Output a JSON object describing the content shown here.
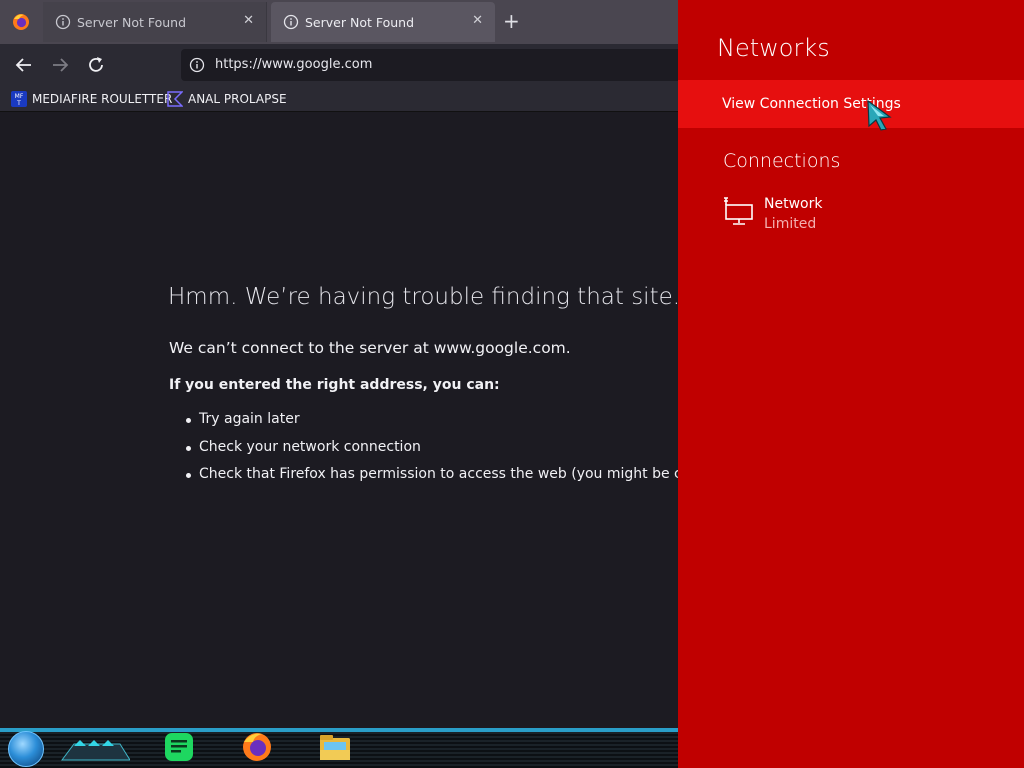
{
  "browser": {
    "tabs": [
      {
        "title": "Server Not Found",
        "active": false
      },
      {
        "title": "Server Not Found",
        "active": true
      }
    ],
    "new_tab_label": "+",
    "close_label": "✕",
    "url": "https://www.google.com",
    "bookmarks": [
      {
        "label": "MEDIAFIRE ROULETTER",
        "icon": "mediafire-icon"
      },
      {
        "label": "ANAL PROLAPSE",
        "icon": "bookmark-triangle-icon"
      }
    ],
    "error": {
      "title": "Hmm. We’re having trouble finding that site.",
      "subtitle": "We can’t connect to the server at www.google.com.",
      "lead": "If you entered the right address, you can:",
      "items": [
        "Try again later",
        "Check your network connection",
        "Check that Firefox has permission to access the web (you might be connected but behind a firewall)"
      ]
    }
  },
  "networks": {
    "title": "Networks",
    "view_settings": "View Connection Settings",
    "connections_title": "Connections",
    "connection": {
      "name": "Network",
      "status": "Limited"
    }
  },
  "colors": {
    "flyout": "#c00000",
    "flyout_highlight": "#e60f0f",
    "browser_bg": "#1c1b22"
  }
}
